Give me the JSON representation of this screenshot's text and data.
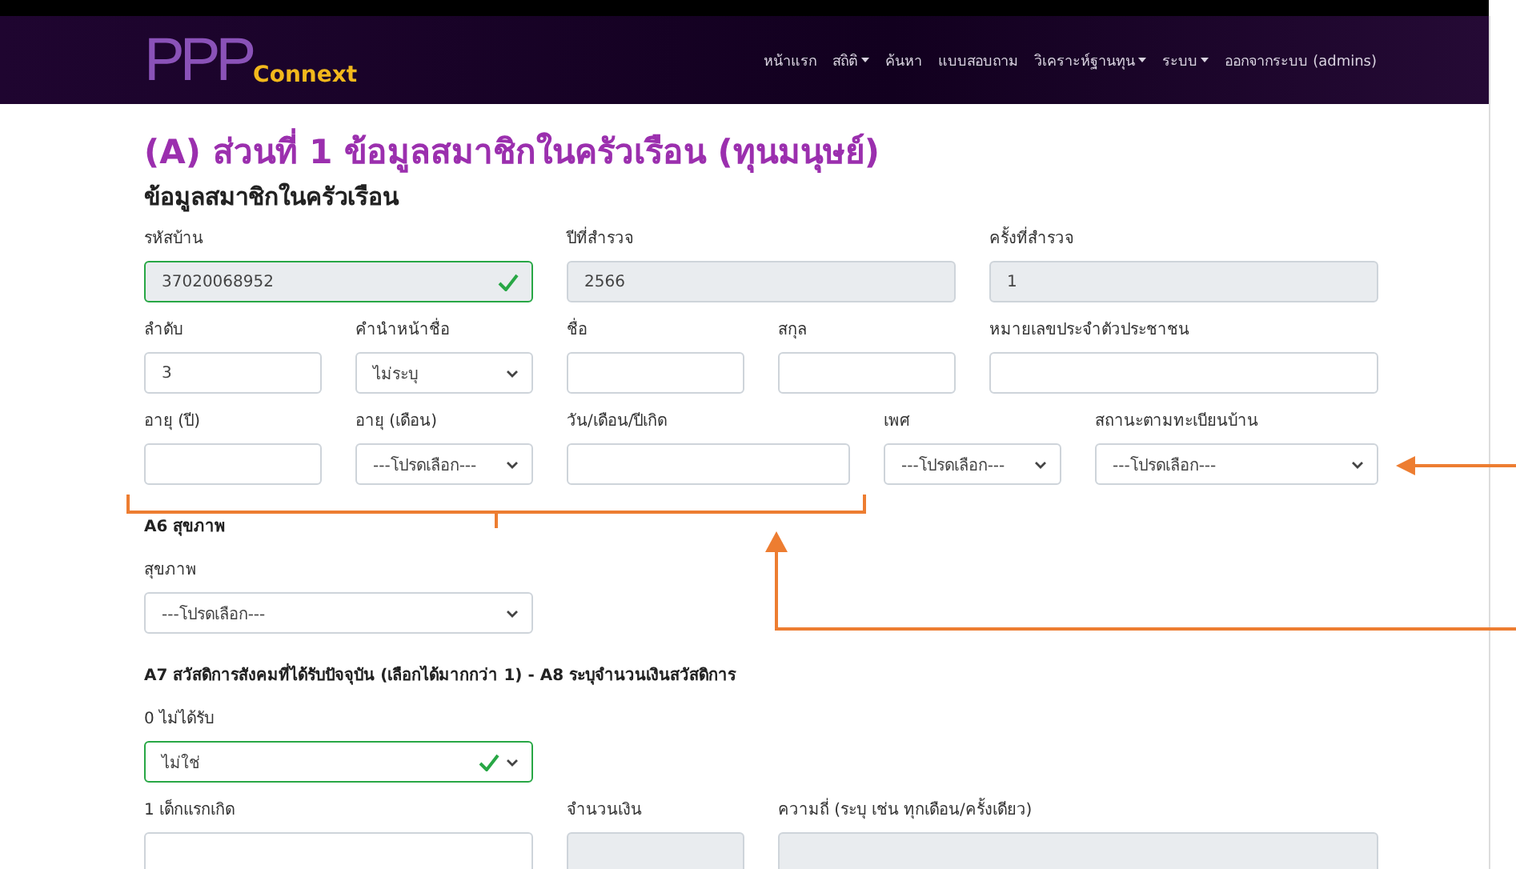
{
  "navbar": {
    "logo_main": "PPP",
    "logo_sub": "Connext",
    "menu": [
      {
        "label": "หน้าแรก",
        "dropdown": false
      },
      {
        "label": "สถิติ",
        "dropdown": true
      },
      {
        "label": "ค้นหา",
        "dropdown": false
      },
      {
        "label": "แบบสอบถาม",
        "dropdown": false
      },
      {
        "label": "วิเคราะห์ฐานทุน",
        "dropdown": true
      },
      {
        "label": "ระบบ",
        "dropdown": true
      },
      {
        "label": "ออกจากระบบ (admins)",
        "dropdown": false
      }
    ]
  },
  "page_title": "(A) ส่วนที่ 1 ข้อมูลสมาชิกในครัวเรือน (ทุนมนุษย์)",
  "section_title": "ข้อมูลสมาชิกในครัวเรือน",
  "sections": [
    {
      "rows": [
        {
          "fields": [
            {
              "label": "รหัสบ้าน",
              "kind": "input",
              "value": "37020068952",
              "readonly": true,
              "valid": true
            },
            {
              "label": "ปีที่สำรวจ",
              "kind": "input",
              "value": "2566",
              "readonly": true,
              "valid": false
            },
            {
              "label": "ครั้งที่สำรวจ",
              "kind": "input",
              "value": "1",
              "readonly": true,
              "valid": false
            }
          ]
        },
        {
          "fields": [
            {
              "label": "ลำดับ",
              "kind": "input",
              "value": "3",
              "readonly": false,
              "valid": false
            },
            {
              "label": "คำนำหน้าชื่อ",
              "kind": "select",
              "value": "ไม่ระบุ",
              "readonly": false,
              "valid": false
            },
            {
              "label": "ชื่อ",
              "kind": "input",
              "readonly": false,
              "valid": false
            },
            {
              "label": "สกุล",
              "kind": "input",
              "readonly": false,
              "valid": false
            },
            {
              "label": "หมายเลขประจำตัวประชาชน",
              "kind": "input",
              "readonly": false,
              "valid": false
            }
          ]
        },
        {
          "fields": [
            {
              "label": "อายุ (ปี)",
              "kind": "input",
              "readonly": false,
              "valid": false
            },
            {
              "label": "อายุ (เดือน)",
              "kind": "select",
              "value": "---โปรดเลือก---",
              "readonly": false,
              "valid": false
            },
            {
              "label": "วัน/เดือน/ปีเกิด",
              "kind": "input",
              "readonly": false,
              "valid": false
            },
            {
              "label": "เพศ",
              "kind": "select",
              "value": "---โปรดเลือก---",
              "readonly": false,
              "valid": false
            },
            {
              "label": "สถานะตามทะเบียนบ้าน",
              "kind": "select",
              "value": "---โปรดเลือก---",
              "readonly": false,
              "valid": false
            }
          ]
        }
      ]
    },
    {
      "heading": "A6 สุขภาพ",
      "rows": [
        {
          "fields": [
            {
              "label": "สุขภาพ",
              "kind": "select",
              "value": "---โปรดเลือก---",
              "readonly": false,
              "valid": false
            }
          ]
        }
      ]
    },
    {
      "heading": "A7 สวัสดิการสังคมที่ได้รับปัจจุบัน (เลือกได้มากกว่า 1) - A8 ระบุจำนวนเงินสวัสดิการ",
      "rows": [
        {
          "fields": [
            {
              "label": "0 ไม่ได้รับ",
              "kind": "select",
              "value": "ไม่ใช่",
              "readonly": false,
              "valid": true
            }
          ]
        },
        {
          "fields": [
            {
              "label": "1 เด็กแรกเกิด",
              "kind": "input",
              "readonly": false,
              "valid": false
            },
            {
              "label": "จำนวนเงิน",
              "kind": "input",
              "readonly": true,
              "valid": false
            },
            {
              "label": "ความถี่ (ระบุ เช่น ทุกเดือน/ครั้งเดียว)",
              "kind": "input",
              "readonly": true,
              "valid": false
            }
          ]
        }
      ]
    }
  ]
}
